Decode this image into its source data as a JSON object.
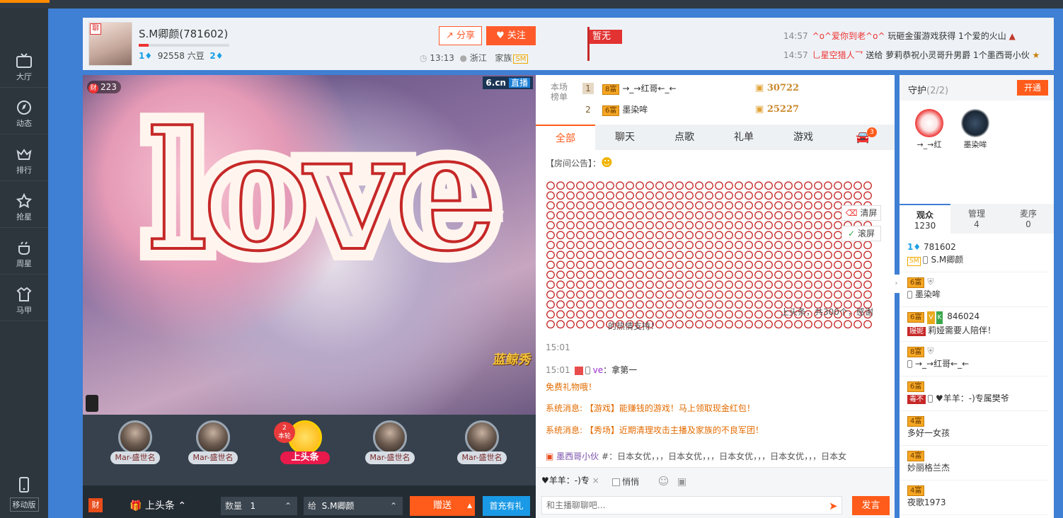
{
  "nav": {
    "items": [
      {
        "label": "大厅",
        "icon": "tv-icon"
      },
      {
        "label": "动态",
        "icon": "compass-icon"
      },
      {
        "label": "排行",
        "icon": "crown-icon"
      },
      {
        "label": "抢星",
        "icon": "star-icon"
      },
      {
        "label": "周星",
        "icon": "pot-icon"
      },
      {
        "label": "马甲",
        "icon": "shirt-icon"
      }
    ],
    "mobile_label": "移动版"
  },
  "anchor": {
    "level_tag": "聊",
    "name": "S.M卿颜(781602)",
    "level_current": "1",
    "beans": "92558 六豆",
    "level_next": "2",
    "share_label": "分享",
    "follow_label": "关注",
    "time": "13:13",
    "location": "浙江",
    "family_label": "家族",
    "family_badge": "SM",
    "flag_label": "暂无"
  },
  "ticker": [
    {
      "time": "14:57",
      "user": "^o^爱你到老^o^",
      "text": " 玩砸金蛋游戏获得 1个爱的火山"
    },
    {
      "time": "14:57",
      "user": "乚星空猎人乛",
      "text": " 送给 萝莉恭祝小灵哥升男爵 1个墨西哥小伙"
    }
  ],
  "video": {
    "viewers": "223",
    "site": "6.cn",
    "live_label": "直播",
    "overlay_word": "love",
    "brand": "蓝鲸秀"
  },
  "gifts": {
    "items": [
      {
        "label": "Mar-盛世名"
      },
      {
        "label": "Mar-盛世名"
      },
      {
        "label": "上头条"
      },
      {
        "label": "Mar-盛世名"
      },
      {
        "label": "Mar-盛世名"
      }
    ],
    "round": {
      "num": "2",
      "label": "本轮"
    }
  },
  "bottom": {
    "cai": "财",
    "headline": "上头条",
    "qty_label": "数量",
    "qty_value": "1",
    "to_label": "给",
    "to_value": "S.M卿颜",
    "give_label": "赠送",
    "recharge_label": "首充有礼"
  },
  "rank": {
    "label": "本场榜单",
    "rows": [
      {
        "num": "1",
        "level": "8富",
        "user": "→_→红哥←_←",
        "score": "30722"
      },
      {
        "num": "2",
        "level": "6富",
        "user": "墨染哞",
        "score": "25227"
      }
    ]
  },
  "chat_tabs": [
    {
      "label": "全部"
    },
    {
      "label": "聊天"
    },
    {
      "label": "点歌"
    },
    {
      "label": "礼单"
    },
    {
      "label": "游戏"
    }
  ],
  "car_badge": "3",
  "chat": {
    "notice": "【房间公告】：",
    "clear_label": "清屏",
    "scroll_label": "滚屏",
    "gift_text": "上头条，共300个，感谢",
    "gift_text2": "的热情支持！",
    "msg1_time": "15:01",
    "msg2_time": "15:01",
    "msg2_user": "ve",
    "msg2_text": "：拿第一",
    "sys1_tail": "免费礼物哦！",
    "sys2": "系统消息: 【游戏】能赚钱的游戏！马上领取现金红包！",
    "sys3": "系统消息: 【秀场】近期清理攻击主播及家族的不良军团！",
    "last_user": "墨西哥小伙",
    "last_text": "#：日本女优，，，日本女优，，，日本女优，，，日本女优，，，日本女"
  },
  "input": {
    "reply_to": "♥羊羊：-)专",
    "whisper_label": "悄悄",
    "placeholder": "和主播聊聊吧...",
    "send_label": "发言"
  },
  "guard": {
    "title": "守护",
    "count": "(2/2)",
    "open_label": "开通",
    "members": [
      {
        "name": "→_→红"
      },
      {
        "name": "墨染哞"
      }
    ]
  },
  "audience_tabs": [
    {
      "label": "观众",
      "count": "1230"
    },
    {
      "label": "管理",
      "count": "4"
    },
    {
      "label": "麦序",
      "count": "0"
    }
  ],
  "audience": [
    {
      "level": "1",
      "id": "781602",
      "badge": "SM",
      "name": "S.M卿颜"
    },
    {
      "level": "6富",
      "name": "墨染哞"
    },
    {
      "level": "6富",
      "id": "846024",
      "badge": "嫚妮",
      "name": "莉娅需要人陪伴！"
    },
    {
      "level": "8富",
      "name": "→_→红哥←_←"
    },
    {
      "level": "6富",
      "badge": "毒不",
      "name": "♥羊羊：-)专属樊爷"
    },
    {
      "level": "4富",
      "name": "多好一女孩"
    },
    {
      "level": "4富",
      "name": "妙丽格兰杰"
    },
    {
      "level": "4富",
      "name": "夜歌1973"
    }
  ]
}
